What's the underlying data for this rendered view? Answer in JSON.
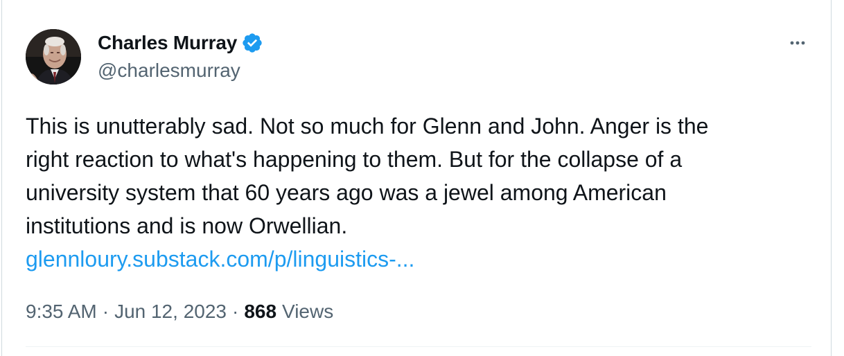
{
  "author": {
    "display_name": "Charles Murray",
    "handle": "@charlesmurray",
    "verified_icon": "verified-badge-icon",
    "avatar_icon": "profile-photo"
  },
  "more_icon": "more-options-icon",
  "tweet": {
    "lines": [
      "This is unutterably sad. Not so much for Glenn and John. Anger is the",
      "right reaction to what's happening to them. But for the collapse of a",
      "university system that 60 years ago was a jewel among American",
      "institutions and is now Orwellian."
    ],
    "link": "glennloury.substack.com/p/linguistics-..."
  },
  "meta": {
    "time": "9:35 AM",
    "separator": "·",
    "date": "Jun 12, 2023",
    "views_count": "868",
    "views_label": "Views"
  },
  "colors": {
    "link": "#1d9bf0",
    "verified": "#1d9bf0",
    "text": "#0f1419",
    "secondary": "#536471"
  }
}
